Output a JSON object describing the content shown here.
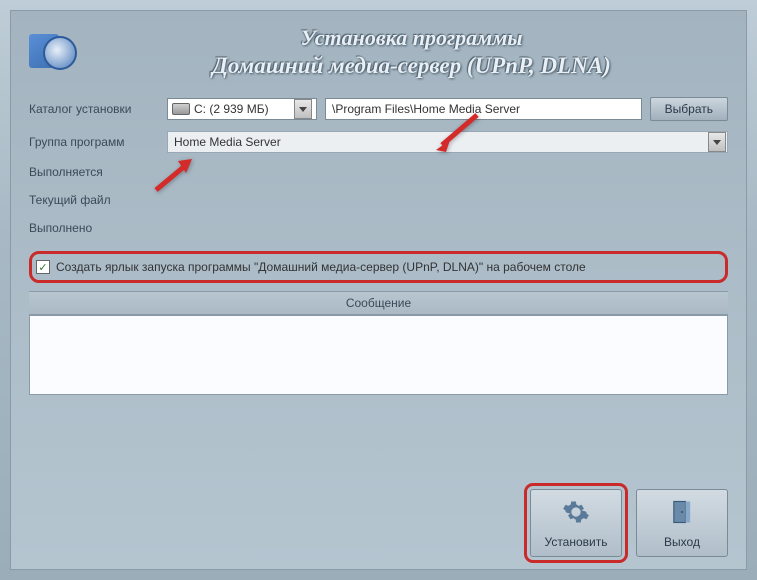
{
  "header": {
    "line1": "Установка программы",
    "line2": "Домашний медиа-сервер (UPnP, DLNA)"
  },
  "labels": {
    "install_catalog": "Каталог установки",
    "program_group": "Группа программ",
    "executing": "Выполняется",
    "current_file": "Текущий файл",
    "completed": "Выполнено"
  },
  "drive": {
    "text": "C: (2 939 МБ)"
  },
  "path": {
    "value": "\\Program Files\\Home Media Server"
  },
  "choose_btn": "Выбрать",
  "group_combo": {
    "value": "Home Media Server"
  },
  "checkbox": {
    "label": "Создать ярлык запуска программы \"Домашний медиа-сервер (UPnP, DLNA)\" на рабочем столе",
    "checked": "✓"
  },
  "messages_header": "Сообщение",
  "footer": {
    "install": "Установить",
    "exit": "Выход"
  }
}
